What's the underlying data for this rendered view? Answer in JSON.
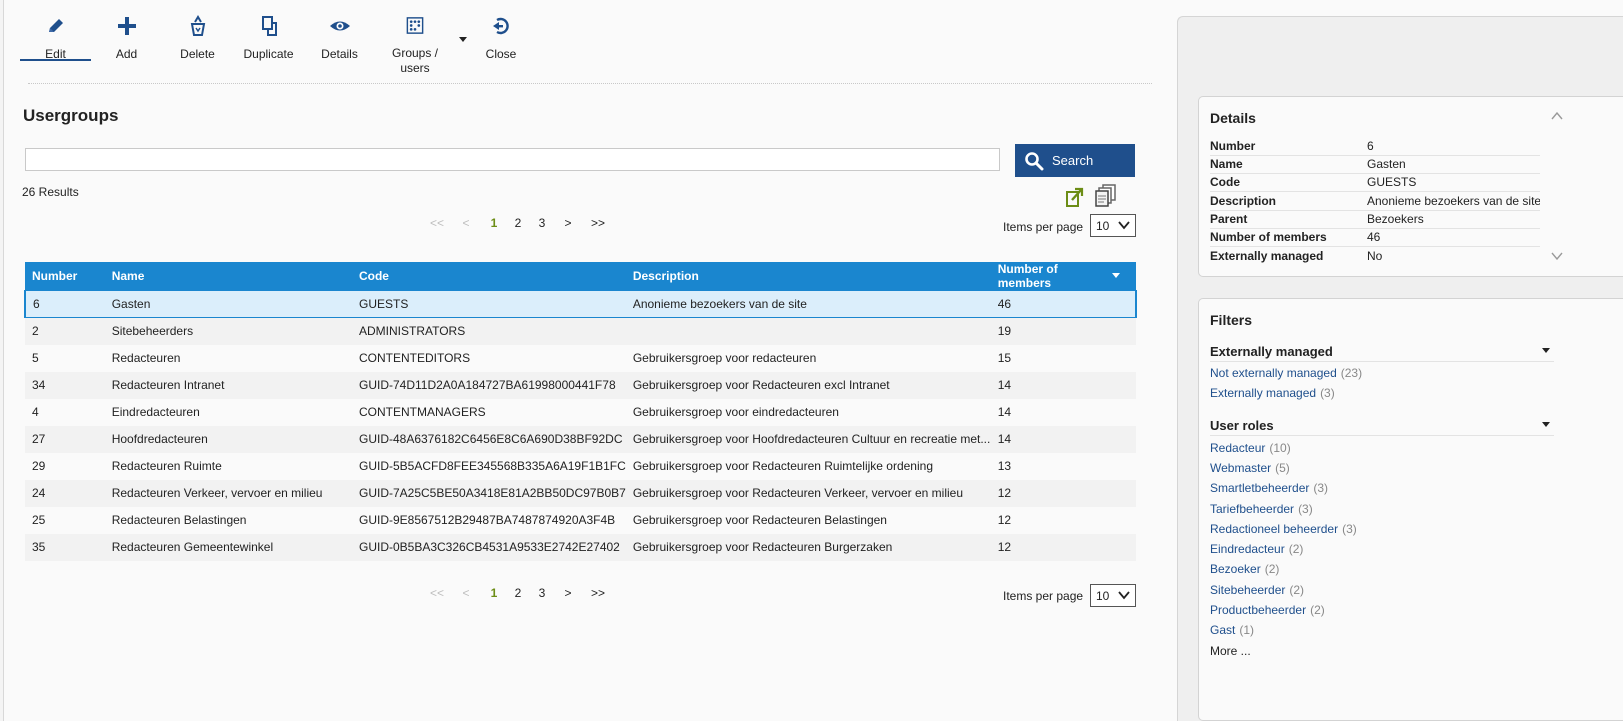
{
  "toolbar": {
    "edit": "Edit",
    "add": "Add",
    "delete": "Delete",
    "duplicate": "Duplicate",
    "details": "Details",
    "groups_users": "Groups / users",
    "close": "Close"
  },
  "main": {
    "title": "Usergroups",
    "search_value": "",
    "search_button": "Search",
    "results": "26 Results",
    "pager": {
      "first": "<<",
      "prev": "<",
      "pages": [
        "1",
        "2",
        "3"
      ],
      "current": "1",
      "next": ">",
      "last": ">>"
    },
    "items_per_page_label": "Items per page",
    "items_per_page_value": "10"
  },
  "table": {
    "columns": [
      "Number",
      "Name",
      "Code",
      "Description",
      "Number of members"
    ],
    "rows": [
      {
        "number": "6",
        "name": "Gasten",
        "code": "GUESTS",
        "description": "Anonieme bezoekers van de site",
        "members": "46"
      },
      {
        "number": "2",
        "name": "Sitebeheerders",
        "code": "ADMINISTRATORS",
        "description": "",
        "members": "19"
      },
      {
        "number": "5",
        "name": "Redacteuren",
        "code": "CONTENTEDITORS",
        "description": "Gebruikersgroep voor redacteuren",
        "members": "15"
      },
      {
        "number": "34",
        "name": "Redacteuren Intranet",
        "code": "GUID-74D11D2A0A184727BA61998000441F78",
        "description": "Gebruikersgroep voor Redacteuren excl Intranet",
        "members": "14"
      },
      {
        "number": "4",
        "name": "Eindredacteuren",
        "code": "CONTENTMANAGERS",
        "description": "Gebruikersgroep voor eindredacteuren",
        "members": "14"
      },
      {
        "number": "27",
        "name": "Hoofdredacteuren",
        "code": "GUID-48A6376182C6456E8C6A690D38BF92DC",
        "description": "Gebruikersgroep voor Hoofdredacteuren Cultuur en recreatie met...",
        "members": "14"
      },
      {
        "number": "29",
        "name": "Redacteuren Ruimte",
        "code": "GUID-5B5ACFD8FEE345568B335A6A19F1B1FC",
        "description": "Gebruikersgroep voor Redacteuren Ruimtelijke ordening",
        "members": "13"
      },
      {
        "number": "24",
        "name": "Redacteuren Verkeer, vervoer en milieu",
        "code": "GUID-7A25C5BE50A3418E81A2BB50DC97B0B7",
        "description": "Gebruikersgroep voor Redacteuren Verkeer, vervoer en milieu",
        "members": "12"
      },
      {
        "number": "25",
        "name": "Redacteuren Belastingen",
        "code": "GUID-9E8567512B29487BA7487874920A3F4B",
        "description": "Gebruikersgroep voor Redacteuren Belastingen",
        "members": "12"
      },
      {
        "number": "35",
        "name": "Redacteuren Gemeentewinkel",
        "code": "GUID-0B5BA3C326CB4531A9533E2742E27402",
        "description": "Gebruikersgroep voor Redacteuren Burgerzaken",
        "members": "12"
      }
    ]
  },
  "details": {
    "title": "Details",
    "fields": [
      {
        "label": "Number",
        "value": "6"
      },
      {
        "label": "Name",
        "value": "Gasten"
      },
      {
        "label": "Code",
        "value": "GUESTS"
      },
      {
        "label": "Description",
        "value": "Anonieme bezoekers van de site"
      },
      {
        "label": "Parent",
        "value": "Bezoekers"
      },
      {
        "label": "Number of members",
        "value": "46"
      },
      {
        "label": "Externally managed",
        "value": "No"
      }
    ]
  },
  "filters": {
    "title": "Filters",
    "externally_managed": {
      "title": "Externally managed",
      "items": [
        {
          "label": "Not externally managed",
          "count": "(23)"
        },
        {
          "label": "Externally managed",
          "count": "(3)"
        }
      ]
    },
    "user_roles": {
      "title": "User roles",
      "items": [
        {
          "label": "Redacteur",
          "count": "(10)"
        },
        {
          "label": "Webmaster",
          "count": "(5)"
        },
        {
          "label": "Smartletbeheerder",
          "count": "(3)"
        },
        {
          "label": "Tariefbeheerder",
          "count": "(3)"
        },
        {
          "label": "Redactioneel beheerder",
          "count": "(3)"
        },
        {
          "label": "Eindredacteur",
          "count": "(2)"
        },
        {
          "label": "Bezoeker",
          "count": "(2)"
        },
        {
          "label": "Sitebeheerder",
          "count": "(2)"
        },
        {
          "label": "Productbeheerder",
          "count": "(2)"
        },
        {
          "label": "Gast",
          "count": "(1)"
        }
      ],
      "more": "More ..."
    }
  },
  "colors": {
    "primary": "#1f4f8c",
    "table_header": "#1a86cf",
    "selected_row": "#dbeefb",
    "current_page": "#6c8d16",
    "link": "#1f4f8c"
  },
  "icons": {
    "edit": "pencil-icon",
    "add": "plus-icon",
    "delete": "recycle-bin-icon",
    "duplicate": "duplicate-icon",
    "details": "eye-icon",
    "groups_users": "user-grid-icon",
    "close": "close-arrow-icon",
    "search": "search-icon",
    "export": "export-icon",
    "copy": "copy-icon"
  }
}
